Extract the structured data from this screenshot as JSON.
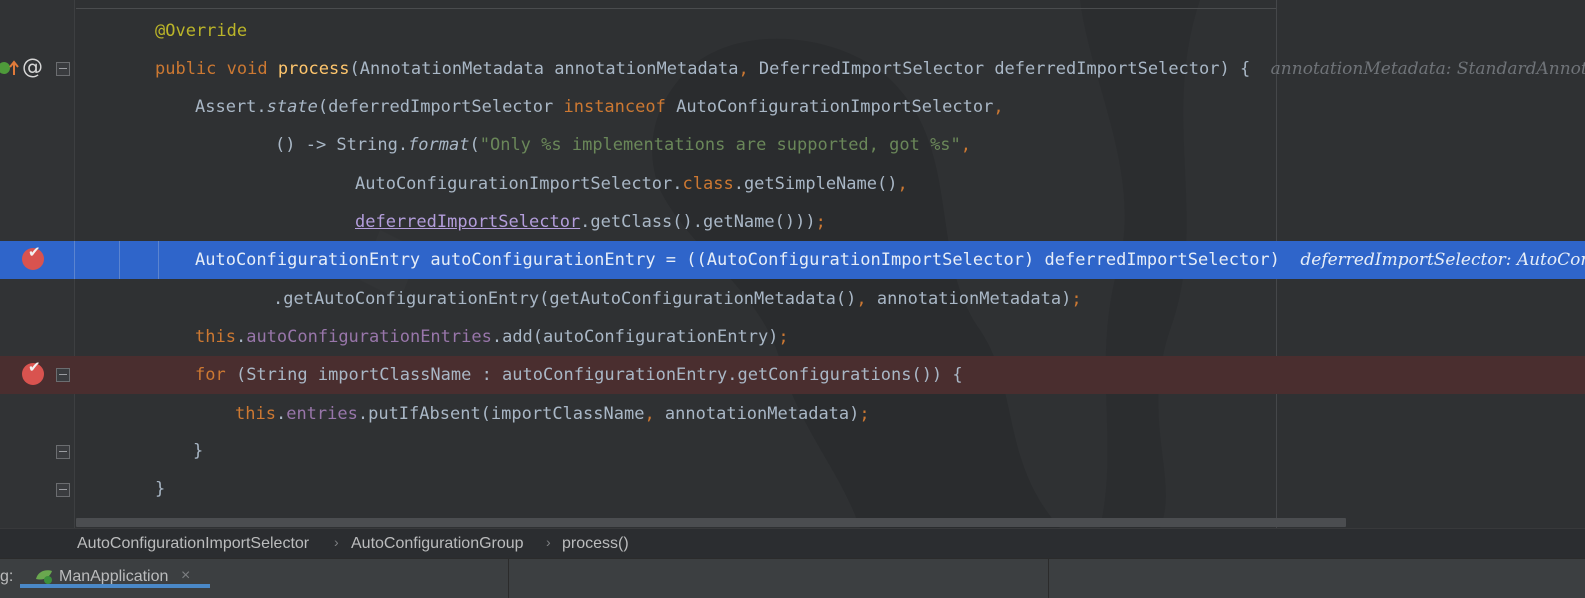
{
  "editor": {
    "lines": [
      {
        "id": "l1",
        "tokens": [
          [
            "ann",
            "@Override"
          ]
        ]
      },
      {
        "id": "l2",
        "tokens": [
          [
            "kw",
            "public "
          ],
          [
            "kw",
            "void "
          ],
          [
            "fn",
            "process"
          ],
          [
            "",
            "(AnnotationMetadata annotationMetadata"
          ],
          [
            "kw",
            ", "
          ],
          [
            "",
            "DeferredImportSelector deferredImportSelector) {  "
          ]
        ],
        "hint": "annotationMetadata: StandardAnnota"
      },
      {
        "id": "l3",
        "tokens": [
          [
            "",
            "Assert."
          ],
          [
            "it",
            "state"
          ],
          [
            "",
            "(deferredImportSelector "
          ],
          [
            "kw",
            "instanceof "
          ],
          [
            "",
            "AutoConfigurationImportSelector"
          ],
          [
            "kw",
            ","
          ]
        ]
      },
      {
        "id": "l4",
        "tokens": [
          [
            "",
            "() -> String."
          ],
          [
            "it",
            "format"
          ],
          [
            "",
            "("
          ],
          [
            "str",
            "\"Only %s implementations are supported, got %s\""
          ],
          [
            "kw",
            ","
          ]
        ]
      },
      {
        "id": "l5",
        "tokens": [
          [
            "",
            "AutoConfigurationImportSelector."
          ],
          [
            "kw",
            "class"
          ],
          [
            "",
            ".getSimpleName()"
          ],
          [
            "kw",
            ","
          ]
        ]
      },
      {
        "id": "l6",
        "tokens": [
          [
            "und",
            "deferredImportSelector"
          ],
          [
            "",
            ".getClass().getName()))"
          ],
          [
            "kw",
            ";"
          ]
        ]
      },
      {
        "id": "l7",
        "tokens": [
          [
            "",
            "AutoConfigurationEntry autoConfigurationEntry = ((AutoConfigurationImportSelector) deferredImportSelector)  "
          ]
        ],
        "hint": "deferredImportSelector: AutoCon"
      },
      {
        "id": "l8",
        "tokens": [
          [
            "",
            ".getAutoConfigurationEntry(getAutoConfigurationMetadata()"
          ],
          [
            "kw",
            ", "
          ],
          [
            "",
            "annotationMetadata)"
          ],
          [
            "kw",
            ";"
          ]
        ]
      },
      {
        "id": "l9",
        "tokens": [
          [
            "kw",
            "this"
          ],
          [
            "",
            "."
          ],
          [
            "fld",
            "autoConfigurationEntries"
          ],
          [
            "",
            ".add(autoConfigurationEntry)"
          ],
          [
            "kw",
            ";"
          ]
        ]
      },
      {
        "id": "l10",
        "tokens": [
          [
            "kw",
            "for "
          ],
          [
            "",
            "(String importClassName : autoConfigurationEntry.getConfigurations()) {"
          ]
        ]
      },
      {
        "id": "l11",
        "tokens": [
          [
            "kw",
            "this"
          ],
          [
            "",
            "."
          ],
          [
            "fld",
            "entries"
          ],
          [
            "",
            ".putIfAbsent(importClassName"
          ],
          [
            "kw",
            ", "
          ],
          [
            "",
            "annotationMetadata)"
          ],
          [
            "kw",
            ";"
          ]
        ]
      },
      {
        "id": "l12",
        "tokens": [
          [
            "",
            "}"
          ]
        ]
      },
      {
        "id": "l13",
        "tokens": [
          [
            "",
            "}"
          ]
        ]
      }
    ]
  },
  "gutter": {
    "override_icon": "override-up-arrow-icon",
    "annotation_symbol": "@",
    "breakpoint_icon": "breakpoint-check-icon",
    "fold_icon": "fold-minus-icon"
  },
  "breadcrumbs": {
    "items": [
      "AutoConfigurationImportSelector",
      "AutoConfigurationGroup",
      "process()"
    ],
    "separator": "›"
  },
  "debug": {
    "label": "g:",
    "tab_label": "ManApplication",
    "tab_icon": "spring-app-icon",
    "close_symbol": "×"
  },
  "colors": {
    "execution_line": "#2f65ca",
    "breakpoint_line": "#4a2e2f",
    "keyword": "#cc7832",
    "annotation": "#bbb529",
    "method": "#ffc66d",
    "string": "#6a8759",
    "field": "#9876aa"
  }
}
